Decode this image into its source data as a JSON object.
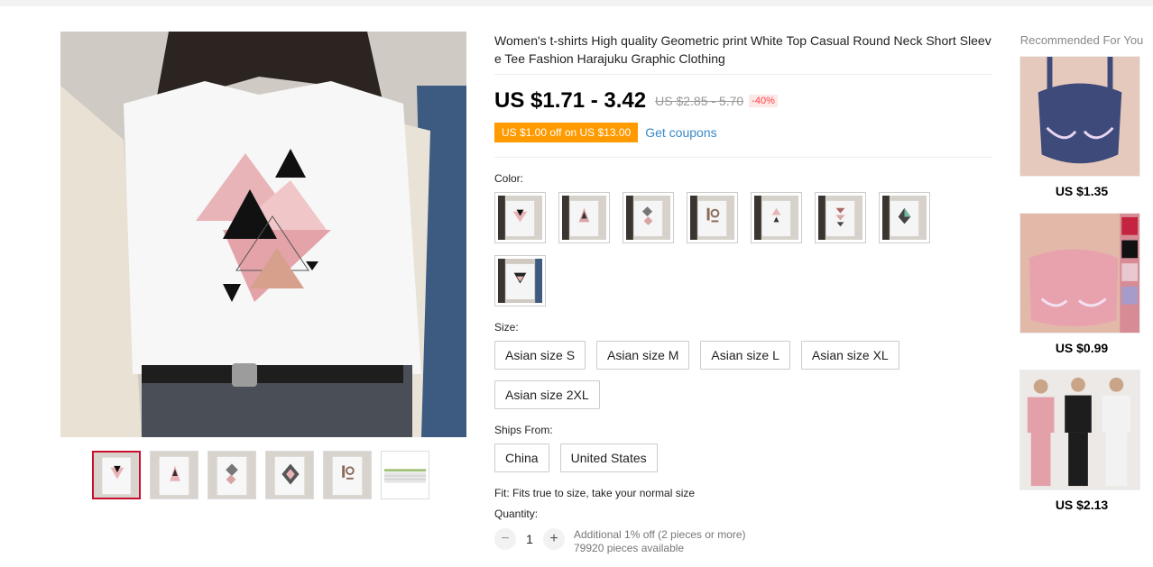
{
  "product": {
    "title": "Women's t-shirts High quality Geometric print White Top Casual Round Neck Short Sleeve Tee Fashion Harajuku Graphic Clothing",
    "price": "US $1.71 - 3.42",
    "original_price": "US $2.85 - 5.70",
    "discount": "-40%",
    "coupon_tag": "US $1.00 off on US $13.00",
    "coupon_link": "Get coupons",
    "colors": {
      "accent_red": "#c8102e",
      "coupon_orange": "#ff9a00",
      "link_blue": "#3a88c9"
    }
  },
  "gallery": {
    "thumbnail_count": 6,
    "active_index": 0
  },
  "variants": {
    "color_label": "Color:",
    "color_swatch_count": 8,
    "size_label": "Size:",
    "sizes": [
      "Asian size S",
      "Asian size M",
      "Asian size L",
      "Asian size XL",
      "Asian size 2XL"
    ],
    "ships_label": "Ships From:",
    "ships_from": [
      "China",
      "United States"
    ]
  },
  "fit_text": "Fit: Fits true to size, take your normal size",
  "quantity": {
    "label": "Quantity:",
    "minus": "−",
    "plus": "+",
    "value": "1",
    "discount_note": "Additional 1% off (2 pieces or more)",
    "available": "79920 pieces available"
  },
  "recommended": {
    "title": "Recommended For You",
    "items": [
      {
        "price": "US $1.35"
      },
      {
        "price": "US $0.99"
      },
      {
        "price": "US $2.13"
      }
    ]
  }
}
